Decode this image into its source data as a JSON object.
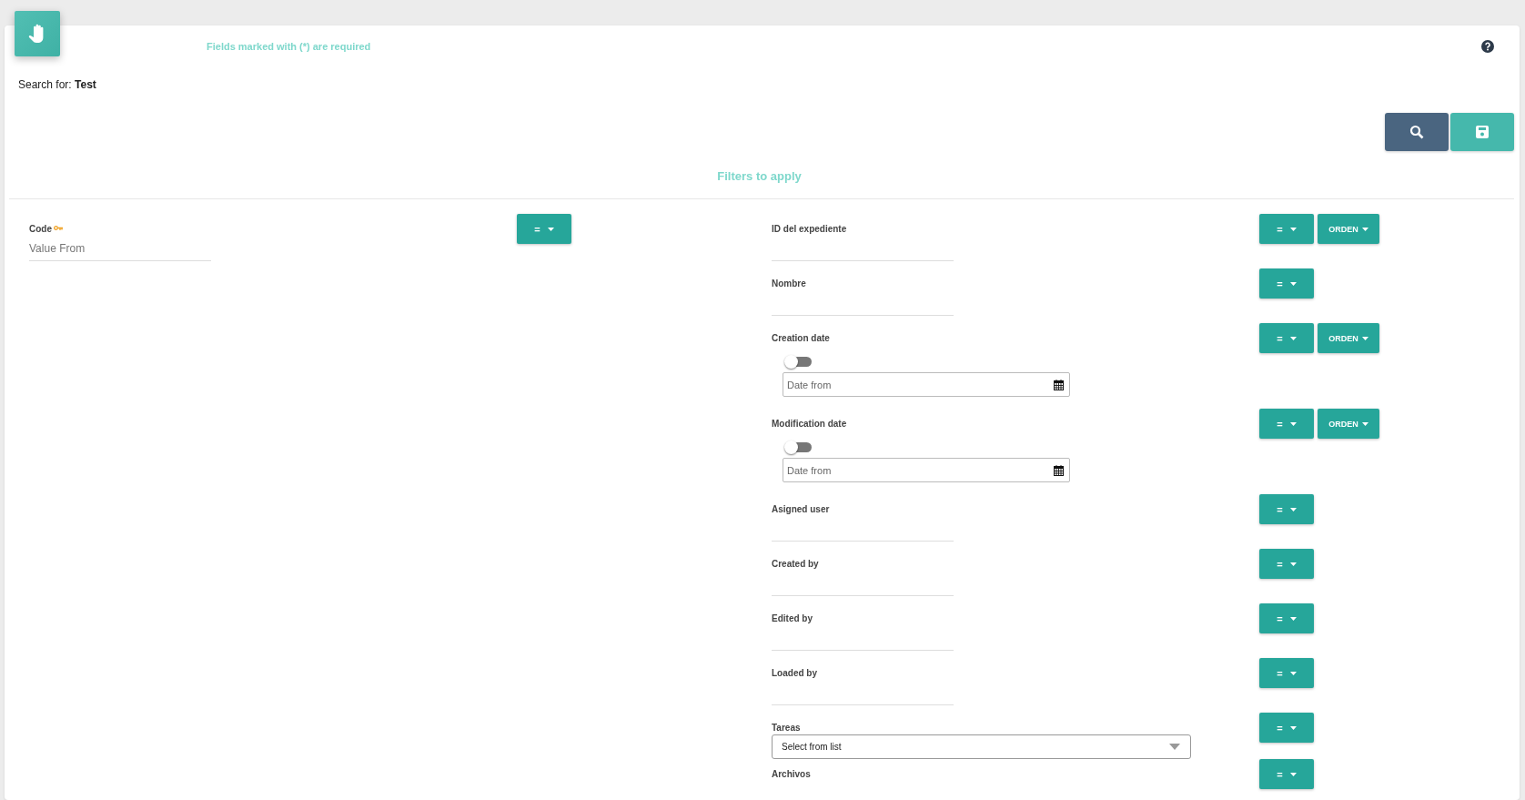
{
  "header": {
    "required_note": "Fields marked with (*) are required",
    "search_label": "Search for:",
    "search_value": "Test"
  },
  "section_title": "Filters to apply",
  "columns": [
    {
      "fields": [
        {
          "kind": "text",
          "label": "Code",
          "key": true,
          "placeholder": "Value From",
          "operator": "="
        }
      ]
    },
    {
      "fields": [
        {
          "kind": "text",
          "label": "ID del expediente",
          "key": false,
          "operator": "=",
          "order": "ORDEN"
        },
        {
          "kind": "text",
          "label": "Nombre",
          "key": false,
          "operator": "="
        },
        {
          "kind": "date",
          "label": "Creation date",
          "key": false,
          "on": false,
          "placeholder": "Date from",
          "operator": "=",
          "order": "ORDEN"
        },
        {
          "kind": "date",
          "label": "Modification date",
          "key": false,
          "on": false,
          "placeholder": "Date from",
          "operator": "=",
          "order": "ORDEN"
        },
        {
          "kind": "text",
          "label": "Asigned user",
          "key": false,
          "operator": "="
        },
        {
          "kind": "text",
          "label": "Created by",
          "key": false,
          "operator": "="
        },
        {
          "kind": "text",
          "label": "Edited by",
          "key": false,
          "operator": "="
        },
        {
          "kind": "text",
          "label": "Loaded by",
          "key": false,
          "operator": "="
        },
        {
          "kind": "select",
          "label": "Tareas",
          "key": false,
          "value": "Select from list",
          "operator": "="
        },
        {
          "kind": "label",
          "label": "Archivos",
          "key": false,
          "operator": "="
        }
      ]
    }
  ]
}
